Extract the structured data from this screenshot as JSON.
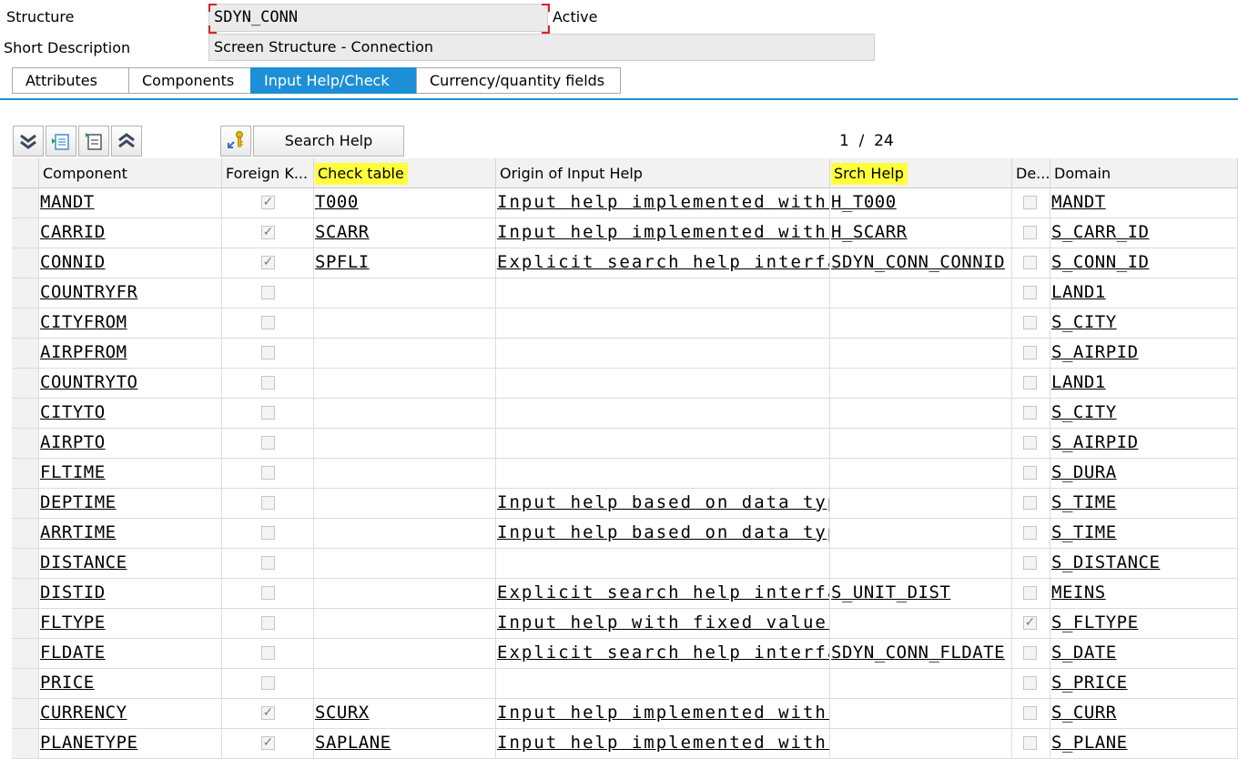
{
  "header": {
    "structure_label": "Structure",
    "structure_value": "SDYN_CONN",
    "status": "Active",
    "short_desc_label": "Short Description",
    "short_desc_value": "Screen Structure - Connection"
  },
  "tabs": [
    {
      "label": "Attributes",
      "active": false
    },
    {
      "label": "Components",
      "active": false
    },
    {
      "label": "Input Help/Check",
      "active": true
    },
    {
      "label": "Currency/quantity fields",
      "active": false
    }
  ],
  "toolbar": {
    "icons": [
      "expand-all-icon",
      "insert-row-icon",
      "delete-row-icon",
      "collapse-all-icon",
      "search-help-key-icon"
    ],
    "search_help_button": "Search Help",
    "pager": "1  /  24"
  },
  "columns": {
    "component": "Component",
    "foreign_key": "Foreign K...",
    "check_table": "Check table",
    "origin": "Origin of Input Help",
    "srch_help": "Srch Help",
    "default": "De...",
    "domain": "Domain"
  },
  "rows": [
    {
      "component": "MANDT",
      "fk": true,
      "check_table": "T000",
      "origin": "Input help implemented with ch",
      "srch_help": "H_T000",
      "def": false,
      "domain": "MANDT"
    },
    {
      "component": "CARRID",
      "fk": true,
      "check_table": "SCARR",
      "origin": "Input help implemented with ch",
      "srch_help": "H_SCARR",
      "def": false,
      "domain": "S_CARR_ID"
    },
    {
      "component": "CONNID",
      "fk": true,
      "check_table": "SPFLI",
      "origin": "Explicit search help interface",
      "srch_help": "SDYN_CONN_CONNID",
      "def": false,
      "domain": "S_CONN_ID"
    },
    {
      "component": "COUNTRYFR",
      "fk": false,
      "check_table": "",
      "origin": "",
      "srch_help": "",
      "def": false,
      "domain": "LAND1"
    },
    {
      "component": "CITYFROM",
      "fk": false,
      "check_table": "",
      "origin": "",
      "srch_help": "",
      "def": false,
      "domain": "S_CITY"
    },
    {
      "component": "AIRPFROM",
      "fk": false,
      "check_table": "",
      "origin": "",
      "srch_help": "",
      "def": false,
      "domain": "S_AIRPID"
    },
    {
      "component": "COUNTRYTO",
      "fk": false,
      "check_table": "",
      "origin": "",
      "srch_help": "",
      "def": false,
      "domain": "LAND1"
    },
    {
      "component": "CITYTO",
      "fk": false,
      "check_table": "",
      "origin": "",
      "srch_help": "",
      "def": false,
      "domain": "S_CITY"
    },
    {
      "component": "AIRPTO",
      "fk": false,
      "check_table": "",
      "origin": "",
      "srch_help": "",
      "def": false,
      "domain": "S_AIRPID"
    },
    {
      "component": "FLTIME",
      "fk": false,
      "check_table": "",
      "origin": "",
      "srch_help": "",
      "def": false,
      "domain": "S_DURA"
    },
    {
      "component": "DEPTIME",
      "fk": false,
      "check_table": "",
      "origin": "Input help based on data type",
      "srch_help": "",
      "def": false,
      "domain": "S_TIME"
    },
    {
      "component": "ARRTIME",
      "fk": false,
      "check_table": "",
      "origin": "Input help based on data type",
      "srch_help": "",
      "def": false,
      "domain": "S_TIME"
    },
    {
      "component": "DISTANCE",
      "fk": false,
      "check_table": "",
      "origin": "",
      "srch_help": "",
      "def": false,
      "domain": "S_DISTANCE"
    },
    {
      "component": "DISTID",
      "fk": false,
      "check_table": "",
      "origin": "Explicit search help interface",
      "srch_help": "S_UNIT_DIST",
      "def": false,
      "domain": "MEINS"
    },
    {
      "component": "FLTYPE",
      "fk": false,
      "check_table": "",
      "origin": "Input help with fixed values",
      "srch_help": "",
      "def": true,
      "domain": "S_FLTYPE"
    },
    {
      "component": "FLDATE",
      "fk": false,
      "check_table": "",
      "origin": "Explicit search help interface",
      "srch_help": "SDYN_CONN_FLDATE",
      "def": false,
      "domain": "S_DATE"
    },
    {
      "component": "PRICE",
      "fk": false,
      "check_table": "",
      "origin": "",
      "srch_help": "",
      "def": false,
      "domain": "S_PRICE"
    },
    {
      "component": "CURRENCY",
      "fk": true,
      "check_table": "SCURX",
      "origin": "Input help implemented with ch",
      "srch_help": "",
      "def": false,
      "domain": "S_CURR"
    },
    {
      "component": "PLANETYPE",
      "fk": true,
      "check_table": "SAPLANE",
      "origin": "Input help implemented with ch",
      "srch_help": "",
      "def": false,
      "domain": "S_PLANE"
    }
  ],
  "colors": {
    "active_tab": "#1d8fd6",
    "column_highlight": "#ffff3c",
    "required_corner": "#d9222a"
  }
}
